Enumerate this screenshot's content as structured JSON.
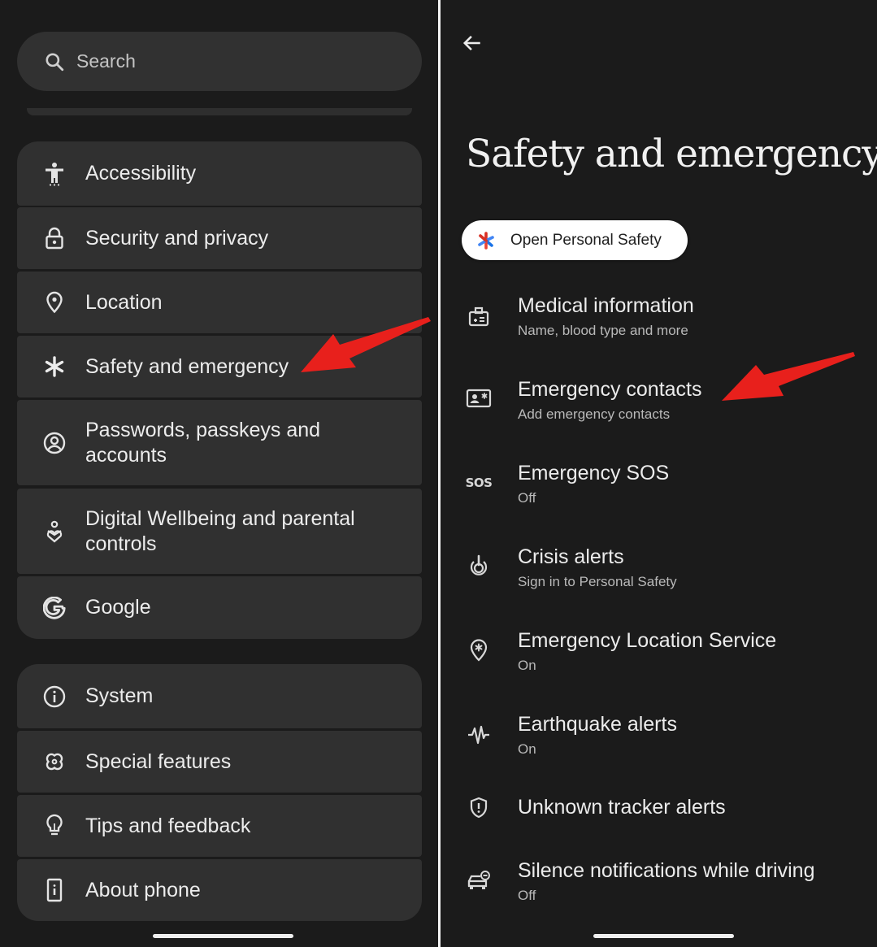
{
  "left": {
    "search": {
      "placeholder": "Search",
      "icon": "search-icon"
    },
    "groups": [
      {
        "items": [
          {
            "label": "Accessibility",
            "icon": "accessibility-icon"
          },
          {
            "label": "Security and privacy",
            "icon": "lock-icon"
          },
          {
            "label": "Location",
            "icon": "location-pin-icon"
          },
          {
            "label": "Safety and emergency",
            "icon": "asterisk-icon"
          },
          {
            "label": "Passwords, passkeys and accounts",
            "icon": "account-circle-icon"
          },
          {
            "label": "Digital Wellbeing and parental controls",
            "icon": "wellbeing-icon"
          },
          {
            "label": "Google",
            "icon": "google-icon"
          }
        ]
      },
      {
        "items": [
          {
            "label": "System",
            "icon": "info-icon"
          },
          {
            "label": "Special features",
            "icon": "special-features-icon"
          },
          {
            "label": "Tips and feedback",
            "icon": "lightbulb-icon"
          },
          {
            "label": "About phone",
            "icon": "phone-icon"
          }
        ]
      }
    ]
  },
  "right": {
    "title": "Safety and emergency",
    "chip": {
      "label": "Open Personal Safety",
      "icon": "personal-safety-icon"
    },
    "items": [
      {
        "title": "Medical information",
        "subtitle": "Name, blood type and more",
        "icon": "medical-id-icon"
      },
      {
        "title": "Emergency contacts",
        "subtitle": "Add emergency contacts",
        "icon": "contact-card-icon"
      },
      {
        "title": "Emergency SOS",
        "subtitle": "Off",
        "icon": "sos-icon",
        "icon_text": "SOS"
      },
      {
        "title": "Crisis alerts",
        "subtitle": "Sign in to Personal Safety",
        "icon": "crisis-alert-icon"
      },
      {
        "title": "Emergency Location Service",
        "subtitle": "On",
        "icon": "emergency-location-icon"
      },
      {
        "title": "Earthquake alerts",
        "subtitle": "On",
        "icon": "earthquake-icon"
      },
      {
        "title": "Unknown tracker alerts",
        "subtitle": "",
        "icon": "shield-alert-icon"
      },
      {
        "title": "Silence notifications while driving",
        "subtitle": "Off",
        "icon": "driving-icon"
      }
    ]
  },
  "colors": {
    "background": "#1b1b1b",
    "card": "#303030",
    "text_primary": "#ececec",
    "text_secondary": "#b9b9b9",
    "annotation_arrow": "#e8201c"
  }
}
